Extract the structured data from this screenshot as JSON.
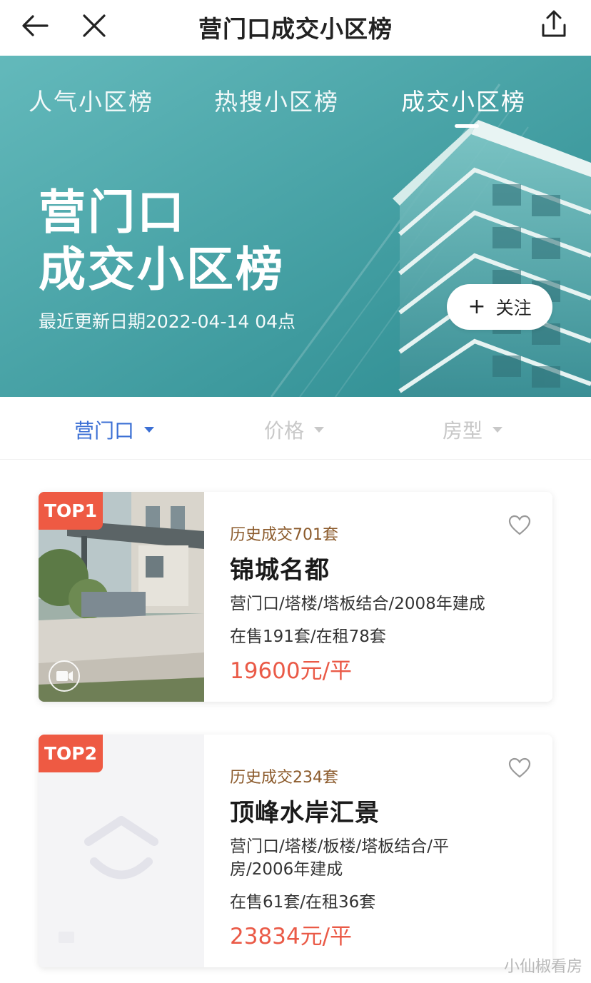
{
  "topbar": {
    "title": "营门口成交小区榜"
  },
  "hero": {
    "tabs": [
      "人气小区榜",
      "热搜小区榜",
      "成交小区榜"
    ],
    "active_tab": "成交小区榜",
    "title_line1": "营门口",
    "title_line2": "成交小区榜",
    "update_text": "最近更新日期2022-04-14 04点",
    "follow_label": "关注"
  },
  "filters": [
    {
      "label": "营门口",
      "active": true
    },
    {
      "label": "价格",
      "active": false
    },
    {
      "label": "房型",
      "active": false
    }
  ],
  "listings": [
    {
      "rank": "TOP1",
      "history": "历史成交701套",
      "name": "锦城名都",
      "desc": "营门口/塔楼/塔板结合/2008年建成",
      "stock": "在售191套/在租78套",
      "price": "19600元/平"
    },
    {
      "rank": "TOP2",
      "history": "历史成交234套",
      "name": "顶峰水岸汇景",
      "desc": "营门口/塔楼/板楼/塔板结合/平房/2006年建成",
      "stock": "在售61套/在租36套",
      "price": "23834元/平"
    }
  ],
  "watermark": "小仙椒看房",
  "colors": {
    "accent_blue": "#3b6fd4",
    "rank_red": "#ee5a43",
    "price_red": "#ea5a47",
    "history_brown": "#8b5a2b",
    "hero_teal": "#4aa9ad"
  }
}
